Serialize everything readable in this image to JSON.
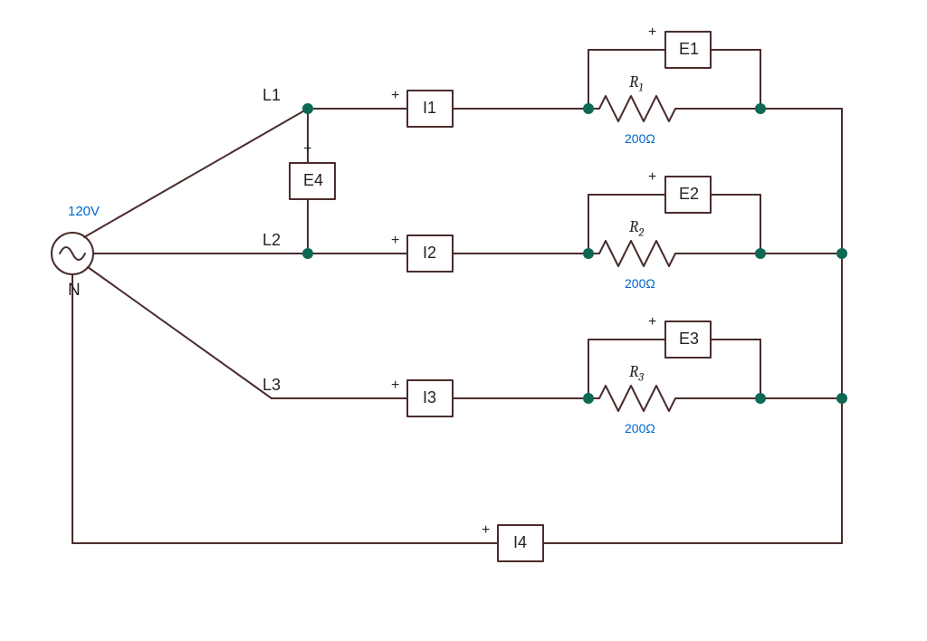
{
  "source": {
    "voltage": "120V",
    "neutral_label": "N"
  },
  "lines": {
    "L1": "L1",
    "L2": "L2",
    "L3": "L3"
  },
  "ammeters": {
    "I1": "I1",
    "I2": "I2",
    "I3": "I3",
    "I4": "I4"
  },
  "voltmeters": {
    "E1": "E1",
    "E2": "E2",
    "E3": "E3",
    "E4": "E4"
  },
  "resistors": {
    "R1": {
      "name_prefix": "R",
      "name_sub": "1",
      "value": "200Ω"
    },
    "R2": {
      "name_prefix": "R",
      "name_sub": "2",
      "value": "200Ω"
    },
    "R3": {
      "name_prefix": "R",
      "name_sub": "3",
      "value": "200Ω"
    }
  },
  "plus": "+"
}
